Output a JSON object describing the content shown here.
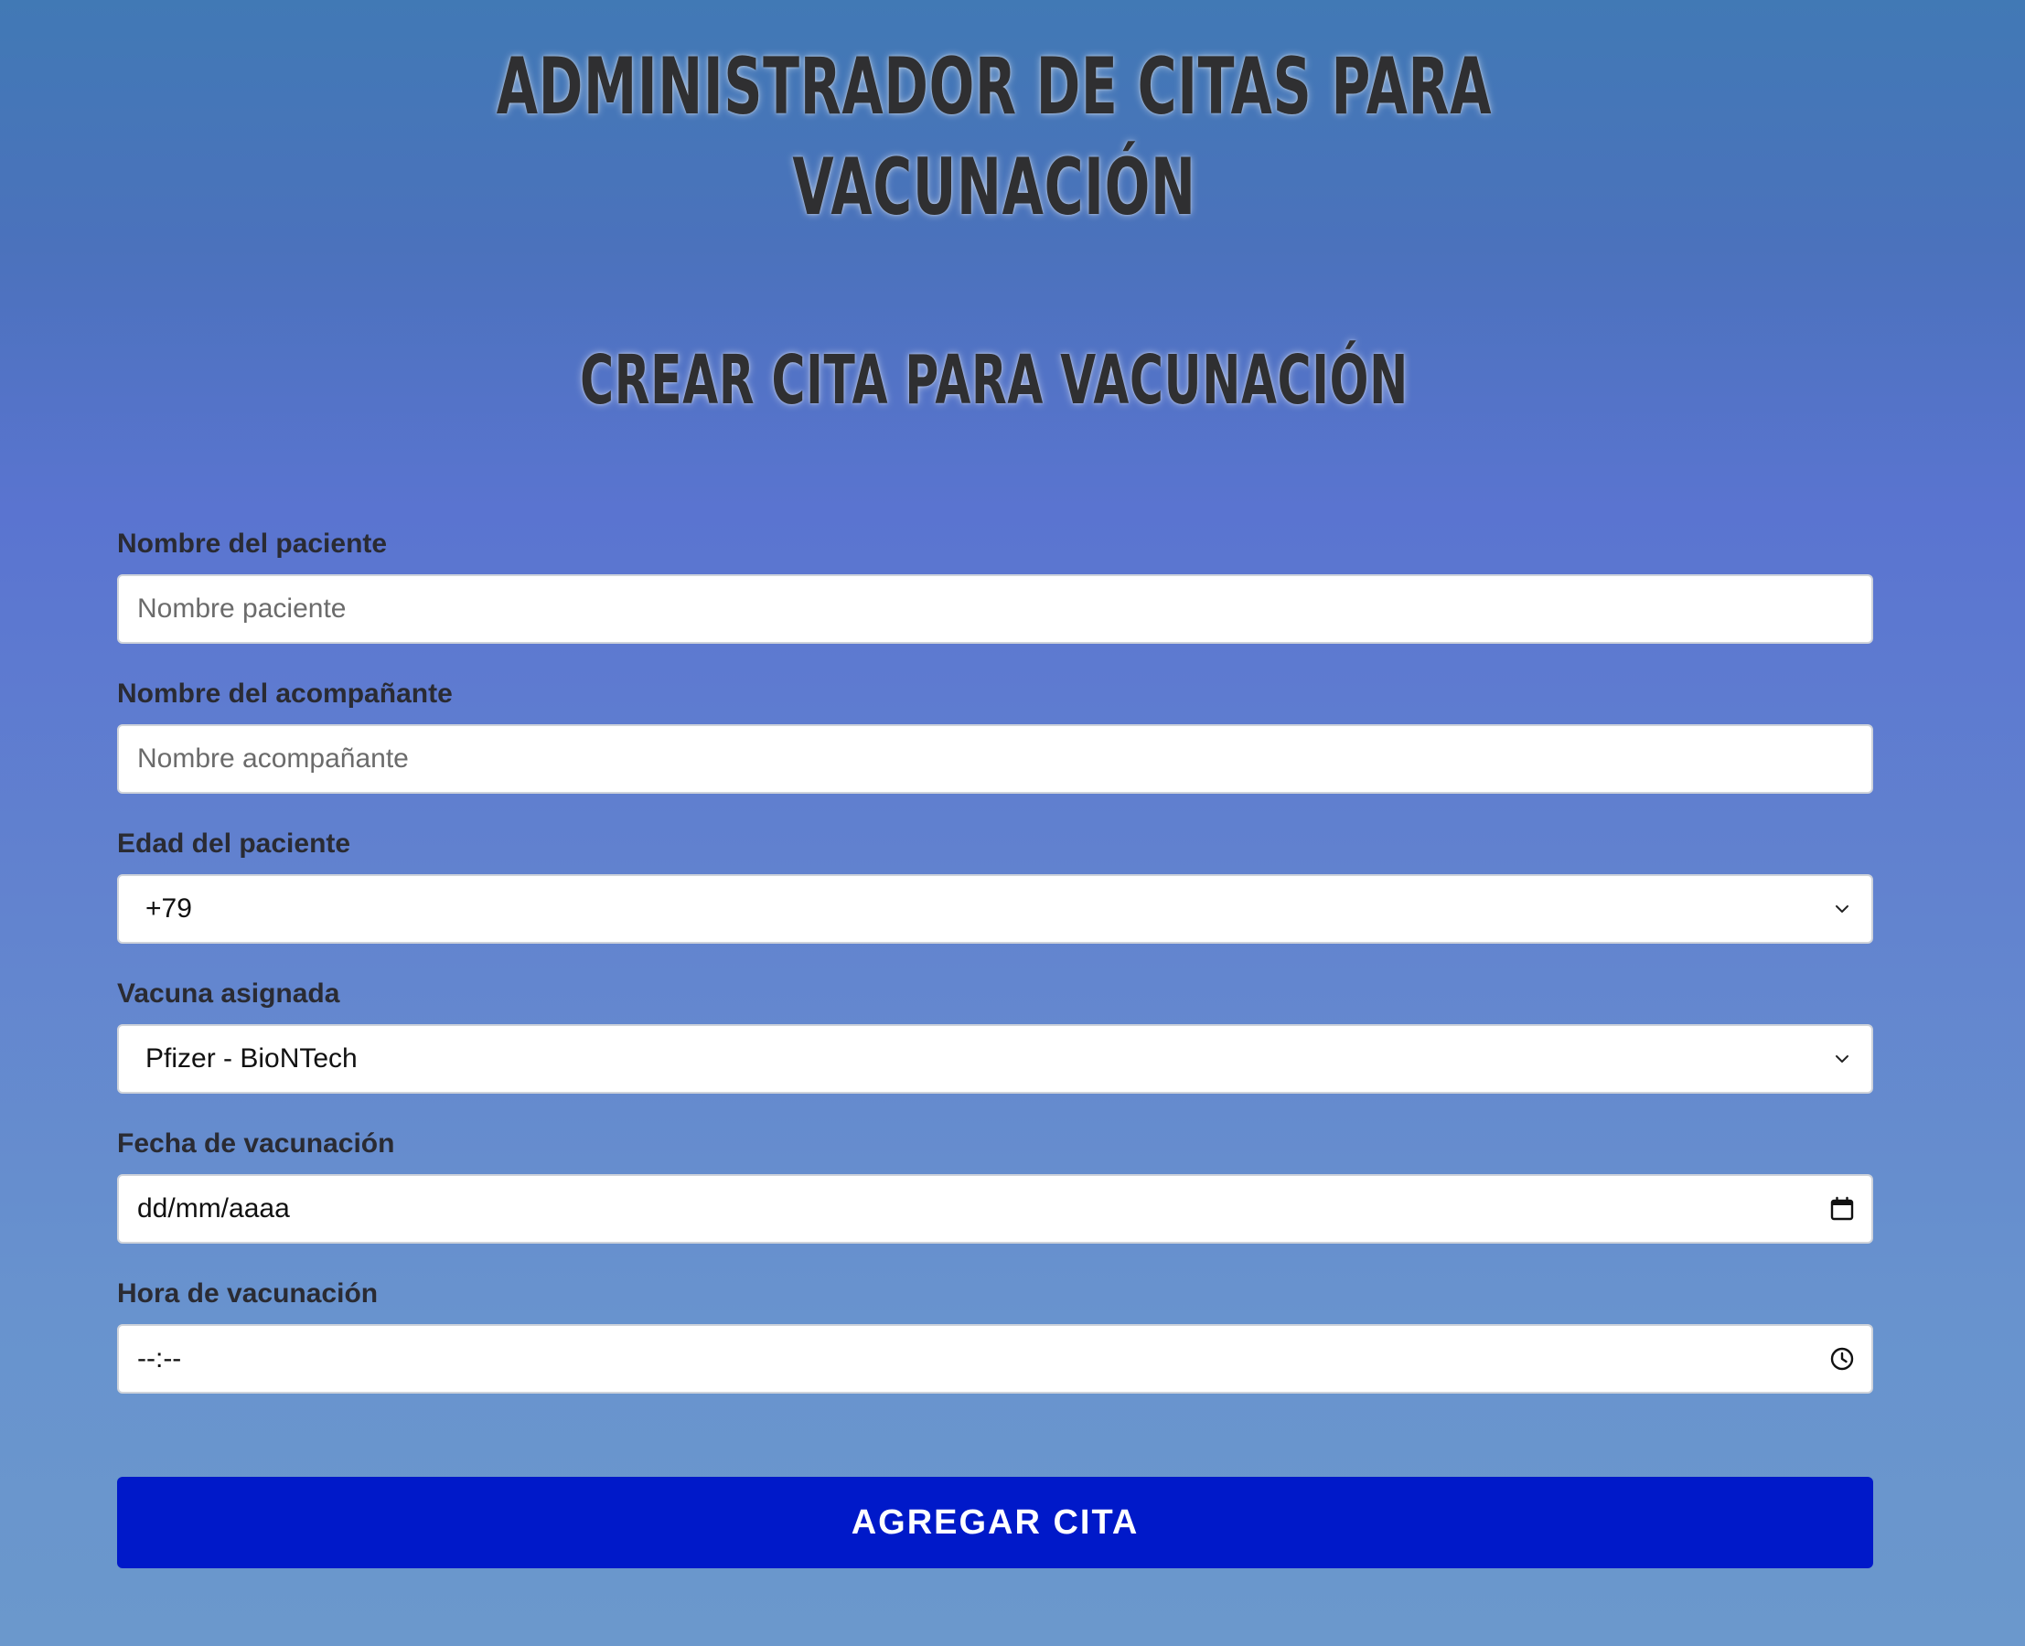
{
  "header": {
    "title": "Administrador de citas para vacunación"
  },
  "form": {
    "title": "Crear cita para vacunación",
    "fields": {
      "patient_name": {
        "label": "Nombre del paciente",
        "placeholder": "Nombre paciente",
        "value": ""
      },
      "companion_name": {
        "label": "Nombre del acompañante",
        "placeholder": "Nombre acompañante",
        "value": ""
      },
      "patient_age": {
        "label": "Edad del paciente",
        "selected": "+79",
        "icon": "chevron-down-icon"
      },
      "vaccine": {
        "label": "Vacuna asignada",
        "selected": "Pfizer - BioNTech",
        "icon": "chevron-down-icon"
      },
      "date": {
        "label": "Fecha de vacunación",
        "display": "dd/mm/aaaa",
        "icon": "calendar-icon"
      },
      "time": {
        "label": "Hora de vacunación",
        "display": "--:--",
        "icon": "clock-icon"
      }
    },
    "submit_label": "Agregar cita"
  },
  "colors": {
    "submit_button": "#0019c9",
    "heading_text": "#2f2f31",
    "background_top": "#4179b5",
    "background_mid": "#5a74d0",
    "background_bottom": "#6b98cc"
  }
}
